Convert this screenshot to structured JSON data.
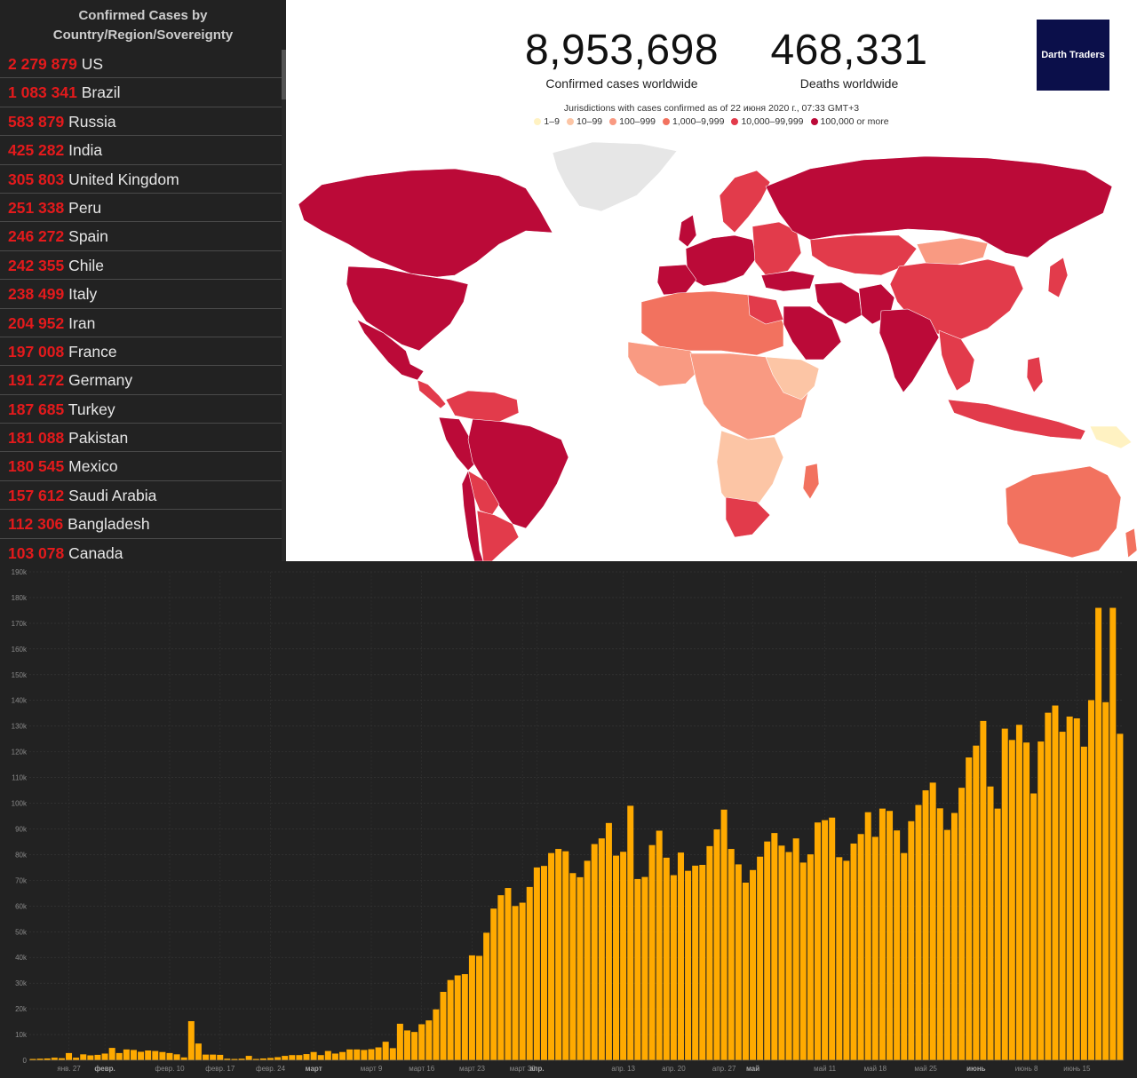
{
  "list": {
    "title_line1": "Confirmed Cases by",
    "title_line2": "Country/Region/Sovereignty",
    "items": [
      {
        "count": "2 279 879",
        "country": "US"
      },
      {
        "count": "1 083 341",
        "country": "Brazil"
      },
      {
        "count": "583 879",
        "country": "Russia"
      },
      {
        "count": "425 282",
        "country": "India"
      },
      {
        "count": "305 803",
        "country": "United Kingdom"
      },
      {
        "count": "251 338",
        "country": "Peru"
      },
      {
        "count": "246 272",
        "country": "Spain"
      },
      {
        "count": "242 355",
        "country": "Chile"
      },
      {
        "count": "238 499",
        "country": "Italy"
      },
      {
        "count": "204 952",
        "country": "Iran"
      },
      {
        "count": "197 008",
        "country": "France"
      },
      {
        "count": "191 272",
        "country": "Germany"
      },
      {
        "count": "187 685",
        "country": "Turkey"
      },
      {
        "count": "181 088",
        "country": "Pakistan"
      },
      {
        "count": "180 545",
        "country": "Mexico"
      },
      {
        "count": "157 612",
        "country": "Saudi Arabia"
      },
      {
        "count": "112 306",
        "country": "Bangladesh"
      },
      {
        "count": "103 078",
        "country": "Canada"
      }
    ]
  },
  "map": {
    "confirmed_value": "8,953,698",
    "confirmed_label": "Confirmed cases worldwide",
    "deaths_value": "468,331",
    "deaths_label": "Deaths worldwide",
    "brand": "Darth Traders",
    "legend_title": "Jurisdictions with cases confirmed as of 22 июня 2020 г., 07:33 GMT+3",
    "legend": [
      {
        "label": "1–9",
        "color": "#fff2c2"
      },
      {
        "label": "10–99",
        "color": "#fcc5a5"
      },
      {
        "label": "100–999",
        "color": "#f99a82"
      },
      {
        "label": "1,000–9,999",
        "color": "#f2725f"
      },
      {
        "label": "10,000–99,999",
        "color": "#e23b4b"
      },
      {
        "label": "100,000 or more",
        "color": "#bb0a38"
      }
    ],
    "colors": {
      "top": "#bb0a38",
      "high": "#e23b4b",
      "mid": "#f2725f",
      "low": "#f99a82",
      "lower": "#fcc5a5",
      "lowest": "#fff2c2",
      "nodata": "#e6e6e6"
    }
  },
  "chart_data": {
    "type": "bar",
    "title": "",
    "xlabel": "",
    "ylabel": "",
    "ylim": [
      0,
      190000
    ],
    "yticks": [
      "0",
      "10k",
      "20k",
      "30k",
      "40k",
      "50k",
      "60k",
      "70k",
      "80k",
      "90k",
      "100k",
      "110k",
      "120k",
      "130k",
      "140k",
      "150k",
      "160k",
      "170k",
      "180k",
      "190k"
    ],
    "bar_color": "#ffaa00",
    "background": "#222222",
    "grid": true,
    "x_start": "янв. 22",
    "x_end": "июнь 16",
    "xtick_labels": [
      {
        "label": "янв. 27",
        "day": 5,
        "bold": false
      },
      {
        "label": "февр.",
        "day": 10,
        "bold": true
      },
      {
        "label": "февр. 10",
        "day": 19,
        "bold": false
      },
      {
        "label": "февр. 17",
        "day": 26,
        "bold": false
      },
      {
        "label": "февр. 24",
        "day": 33,
        "bold": false
      },
      {
        "label": "март",
        "day": 39,
        "bold": true
      },
      {
        "label": "март 9",
        "day": 47,
        "bold": false
      },
      {
        "label": "март 16",
        "day": 54,
        "bold": false
      },
      {
        "label": "март 23",
        "day": 61,
        "bold": false
      },
      {
        "label": "март 30",
        "day": 68,
        "bold": false
      },
      {
        "label": "апр.",
        "day": 70,
        "bold": true
      },
      {
        "label": "апр. 13",
        "day": 82,
        "bold": false
      },
      {
        "label": "апр. 20",
        "day": 89,
        "bold": false
      },
      {
        "label": "апр. 27",
        "day": 96,
        "bold": false
      },
      {
        "label": "май",
        "day": 100,
        "bold": true
      },
      {
        "label": "май 11",
        "day": 110,
        "bold": false
      },
      {
        "label": "май 18",
        "day": 117,
        "bold": false
      },
      {
        "label": "май 25",
        "day": 124,
        "bold": false
      },
      {
        "label": "июнь",
        "day": 131,
        "bold": true
      },
      {
        "label": "июнь 8",
        "day": 138,
        "bold": false
      },
      {
        "label": "июнь 15",
        "day": 145,
        "bold": false
      }
    ],
    "values": [
      500,
      600,
      700,
      1000,
      800,
      2800,
      1000,
      2300,
      1900,
      2100,
      2600,
      4800,
      2800,
      4200,
      4000,
      3300,
      3800,
      3600,
      3200,
      2800,
      2300,
      1100,
      15200,
      6500,
      2200,
      2200,
      2100,
      600,
      500,
      600,
      1700,
      500,
      700,
      900,
      1200,
      1700,
      2000,
      2000,
      2400,
      3200,
      2000,
      3600,
      2600,
      3200,
      4200,
      4200,
      4000,
      4300,
      5000,
      7200,
      4700,
      14200,
      11600,
      11000,
      14000,
      15500,
      19800,
      26600,
      31200,
      33000,
      33500,
      40800,
      40600,
      49600,
      59000,
      64200,
      67000,
      60000,
      61300,
      67400,
      75000,
      75600,
      80600,
      82200,
      81300,
      72800,
      71200,
      77600,
      84100,
      86300,
      92300,
      79600,
      81100,
      99000,
      70500,
      71300,
      83700,
      89300,
      78800,
      72000,
      80800,
      73700,
      75700,
      76000,
      83300,
      89800,
      97500,
      82200,
      76200,
      69100,
      74000,
      79200,
      85100,
      88400,
      83500,
      81000,
      86300,
      76900,
      80100,
      92500,
      93400,
      94400,
      79000,
      77600,
      84300,
      88000,
      96500,
      86900,
      97900,
      97000,
      89400,
      80600,
      93000,
      99300,
      105000,
      108000,
      98000,
      89600,
      96200,
      106000,
      117800,
      122400,
      132000,
      106500,
      97900,
      129000,
      124600,
      130500,
      123600,
      103800,
      124000,
      135200,
      138000,
      127800,
      133700,
      133000,
      122000,
      140100,
      176000,
      139300,
      176000,
      127000
    ]
  }
}
